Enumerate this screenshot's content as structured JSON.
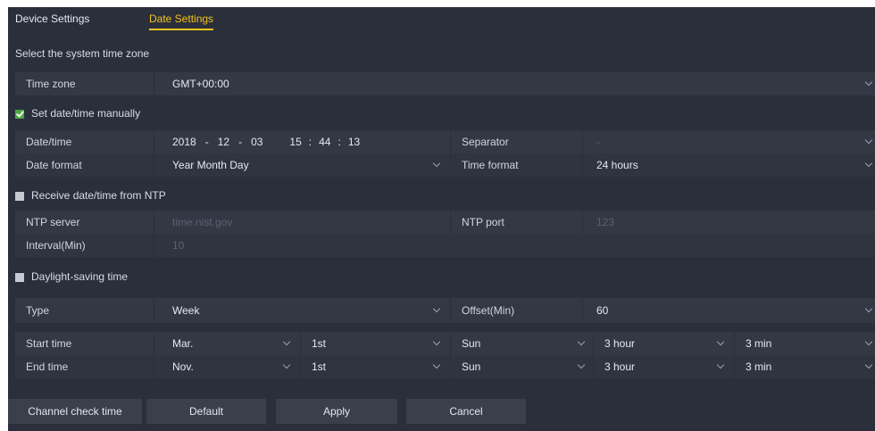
{
  "tabs": [
    {
      "label": "Device Settings",
      "active": false
    },
    {
      "label": "Date Settings",
      "active": true
    }
  ],
  "timezone_section": {
    "title": "Select the system time zone"
  },
  "timezone": {
    "label": "Time zone",
    "value": "GMT+00:00"
  },
  "manual": {
    "label": "Set date/time manually",
    "checked": true
  },
  "datetime": {
    "label": "Date/time",
    "year": "2018",
    "month": "12",
    "day": "03",
    "date_separator": "-",
    "hour": "15",
    "minute": "44",
    "second": "13",
    "time_separator": ":"
  },
  "separator": {
    "label": "Separator",
    "value": "-"
  },
  "date_format": {
    "label": "Date format",
    "value": "Year Month Day"
  },
  "time_format": {
    "label": "Time format",
    "value": "24 hours"
  },
  "ntp": {
    "label": "Receive date/time from NTP",
    "checked": false,
    "server_label": "NTP server",
    "server_value": "time.nist.gov",
    "port_label": "NTP port",
    "port_value": "123",
    "interval_label": "Interval(Min)",
    "interval_value": "10"
  },
  "dst": {
    "label": "Daylight-saving time",
    "checked": false,
    "type_label": "Type",
    "type_value": "Week",
    "offset_label": "Offset(Min)",
    "offset_value": "60",
    "start": {
      "label": "Start time",
      "month": "Mar.",
      "week": "1st",
      "day": "Sun",
      "hour": "3 hour",
      "minute": "3 min"
    },
    "end": {
      "label": "End time",
      "month": "Nov.",
      "week": "1st",
      "day": "Sun",
      "hour": "3 hour",
      "minute": "3 min"
    }
  },
  "buttons": {
    "channel_check": "Channel check time",
    "default": "Default",
    "apply": "Apply",
    "cancel": "Cancel"
  },
  "colors": {
    "background": "#2b2f3b",
    "row_alt_a": "#333845",
    "row_alt_b": "#2f3440",
    "accent": "#f2c21c",
    "check_on": "#4ea54a"
  }
}
